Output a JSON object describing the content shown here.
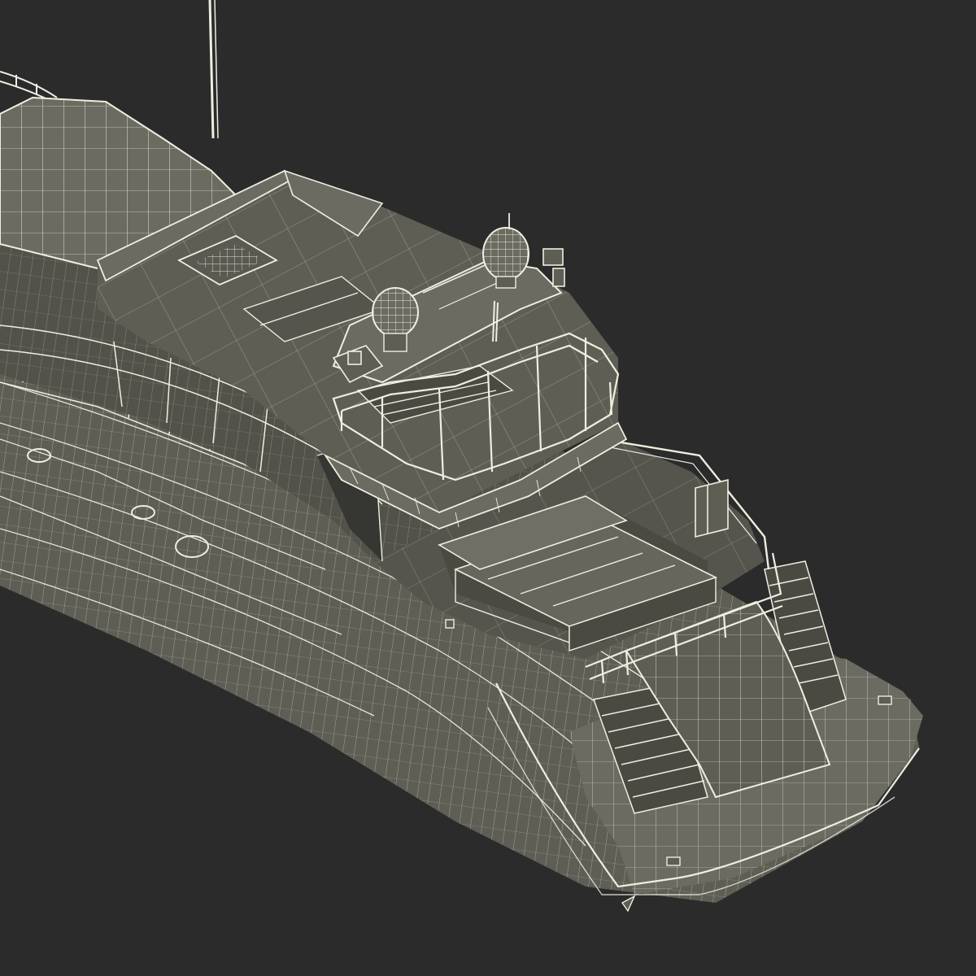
{
  "scene": {
    "background": "#2b2b2b",
    "surface": "#5e5e55",
    "surface_light": "#6b6b61",
    "surface_dark": "#4a4a43",
    "shadow": "#363632",
    "wire": "#efeee0"
  }
}
